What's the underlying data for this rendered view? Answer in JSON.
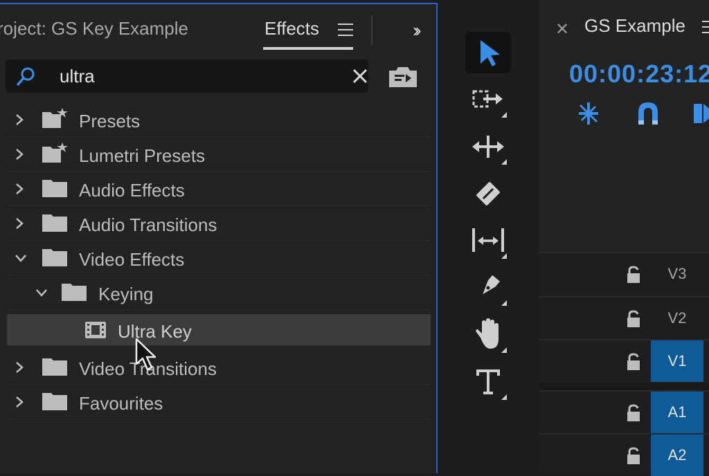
{
  "effects_panel": {
    "project_tab": "roject: GS Key Example",
    "effects_tab": "Effects",
    "search": {
      "value": "ultra"
    },
    "tree": [
      {
        "label": "Presets",
        "icon": "preset-folder-icon",
        "expanded": false
      },
      {
        "label": "Lumetri Presets",
        "icon": "preset-folder-icon",
        "expanded": false
      },
      {
        "label": "Audio Effects",
        "icon": "folder-icon",
        "expanded": false
      },
      {
        "label": "Audio Transitions",
        "icon": "folder-icon",
        "expanded": false
      },
      {
        "label": "Video Effects",
        "icon": "folder-icon",
        "expanded": true
      },
      {
        "label": "Keying",
        "icon": "folder-icon",
        "expanded": true
      },
      {
        "label": "Ultra Key",
        "icon": "effect-icon",
        "selected": true
      },
      {
        "label": "Video Transitions",
        "icon": "folder-icon",
        "expanded": false
      },
      {
        "label": "Favourites",
        "icon": "folder-icon",
        "expanded": false
      }
    ]
  },
  "tools": [
    {
      "name": "selection-tool",
      "active": true
    },
    {
      "name": "track-select-forward-tool"
    },
    {
      "name": "ripple-edit-tool"
    },
    {
      "name": "razor-tool"
    },
    {
      "name": "slip-tool"
    },
    {
      "name": "pen-tool"
    },
    {
      "name": "hand-tool"
    },
    {
      "name": "type-tool"
    }
  ],
  "timeline": {
    "title": "GS Example",
    "timecode": "00:00:23:12",
    "tracks": [
      {
        "label": "V3",
        "targeted": false
      },
      {
        "label": "V2",
        "targeted": false
      },
      {
        "label": "V1",
        "targeted": true
      },
      {
        "label": "A1",
        "targeted": true
      },
      {
        "label": "A2",
        "targeted": true
      }
    ]
  },
  "colors": {
    "accent": "#3a8ee6",
    "panel_border": "#2d5fd0",
    "track_target": "#0e5b9a"
  }
}
